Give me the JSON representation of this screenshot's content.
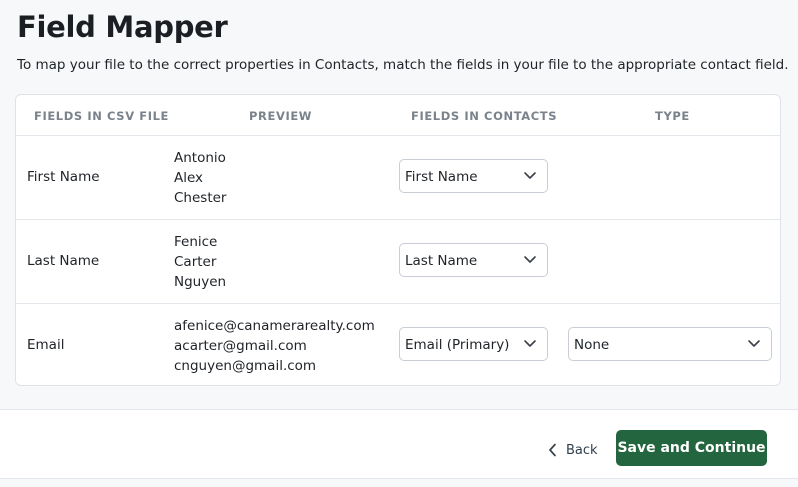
{
  "header": {
    "title": "Field Mapper",
    "subtitle": "To map your file to the correct properties in Contacts, match the fields in your file to the appropriate contact field."
  },
  "table": {
    "columns": {
      "csv": "FIELDS IN CSV FILE",
      "preview": "PREVIEW",
      "contacts": "FIELDS IN CONTACTS",
      "type": "TYPE"
    },
    "rows": [
      {
        "csv_field": "First Name",
        "preview": [
          "Antonio",
          "Alex",
          "Chester"
        ],
        "contact_field": "First Name"
      },
      {
        "csv_field": "Last Name",
        "preview": [
          "Fenice",
          "Carter",
          "Nguyen"
        ],
        "contact_field": "Last Name"
      },
      {
        "csv_field": "Email",
        "preview": [
          "afenice@canamerarealty.com",
          "acarter@gmail.com",
          "cnguyen@gmail.com"
        ],
        "contact_field": "Email (Primary)",
        "type": "None"
      }
    ]
  },
  "footer": {
    "back_label": "Back",
    "save_label": "Save and Continue"
  },
  "colors": {
    "primary": "#23653f",
    "border": "#dfe2e6",
    "header_text": "#7a828b"
  },
  "icons": {
    "dropdown": "chevron-down-icon",
    "back": "chevron-left-icon"
  }
}
